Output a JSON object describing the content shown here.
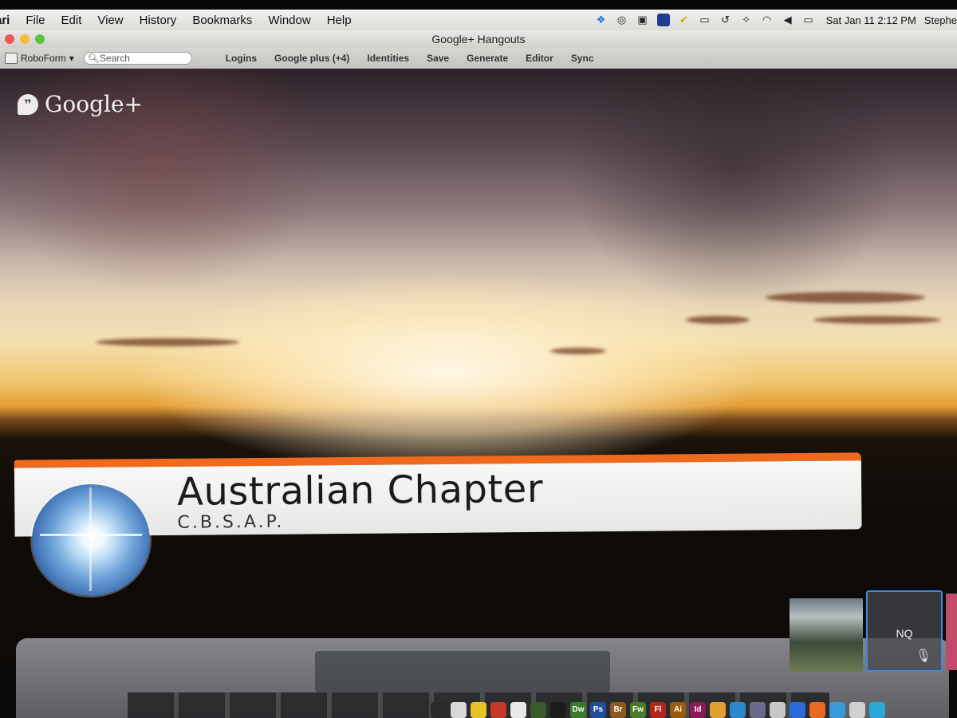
{
  "menubar": {
    "app_partial": "ari",
    "items": [
      "File",
      "Edit",
      "View",
      "History",
      "Bookmarks",
      "Window",
      "Help"
    ],
    "clock": "Sat Jan 11  2:12 PM",
    "user_partial": "Stephe"
  },
  "window": {
    "title": "Google+ Hangouts"
  },
  "toolbar": {
    "roboform_label": "RoboForm",
    "search_placeholder": "Search",
    "items": [
      "Logins",
      "Google plus (+4)",
      "Identities",
      "Save",
      "Generate",
      "Editor",
      "Sync"
    ]
  },
  "hangout": {
    "brand_label": "Google+",
    "banner_title": "Australian Chapter",
    "banner_subtitle": "C.B.S.A.P.",
    "participant_label": "NQ",
    "accent_color": "#f06a1e",
    "selected_border_color": "#3d8ae6"
  },
  "dock": {
    "apps": [
      "Dw",
      "Ps",
      "Br",
      "Fw",
      "Fl",
      "Ai",
      "Id"
    ]
  }
}
